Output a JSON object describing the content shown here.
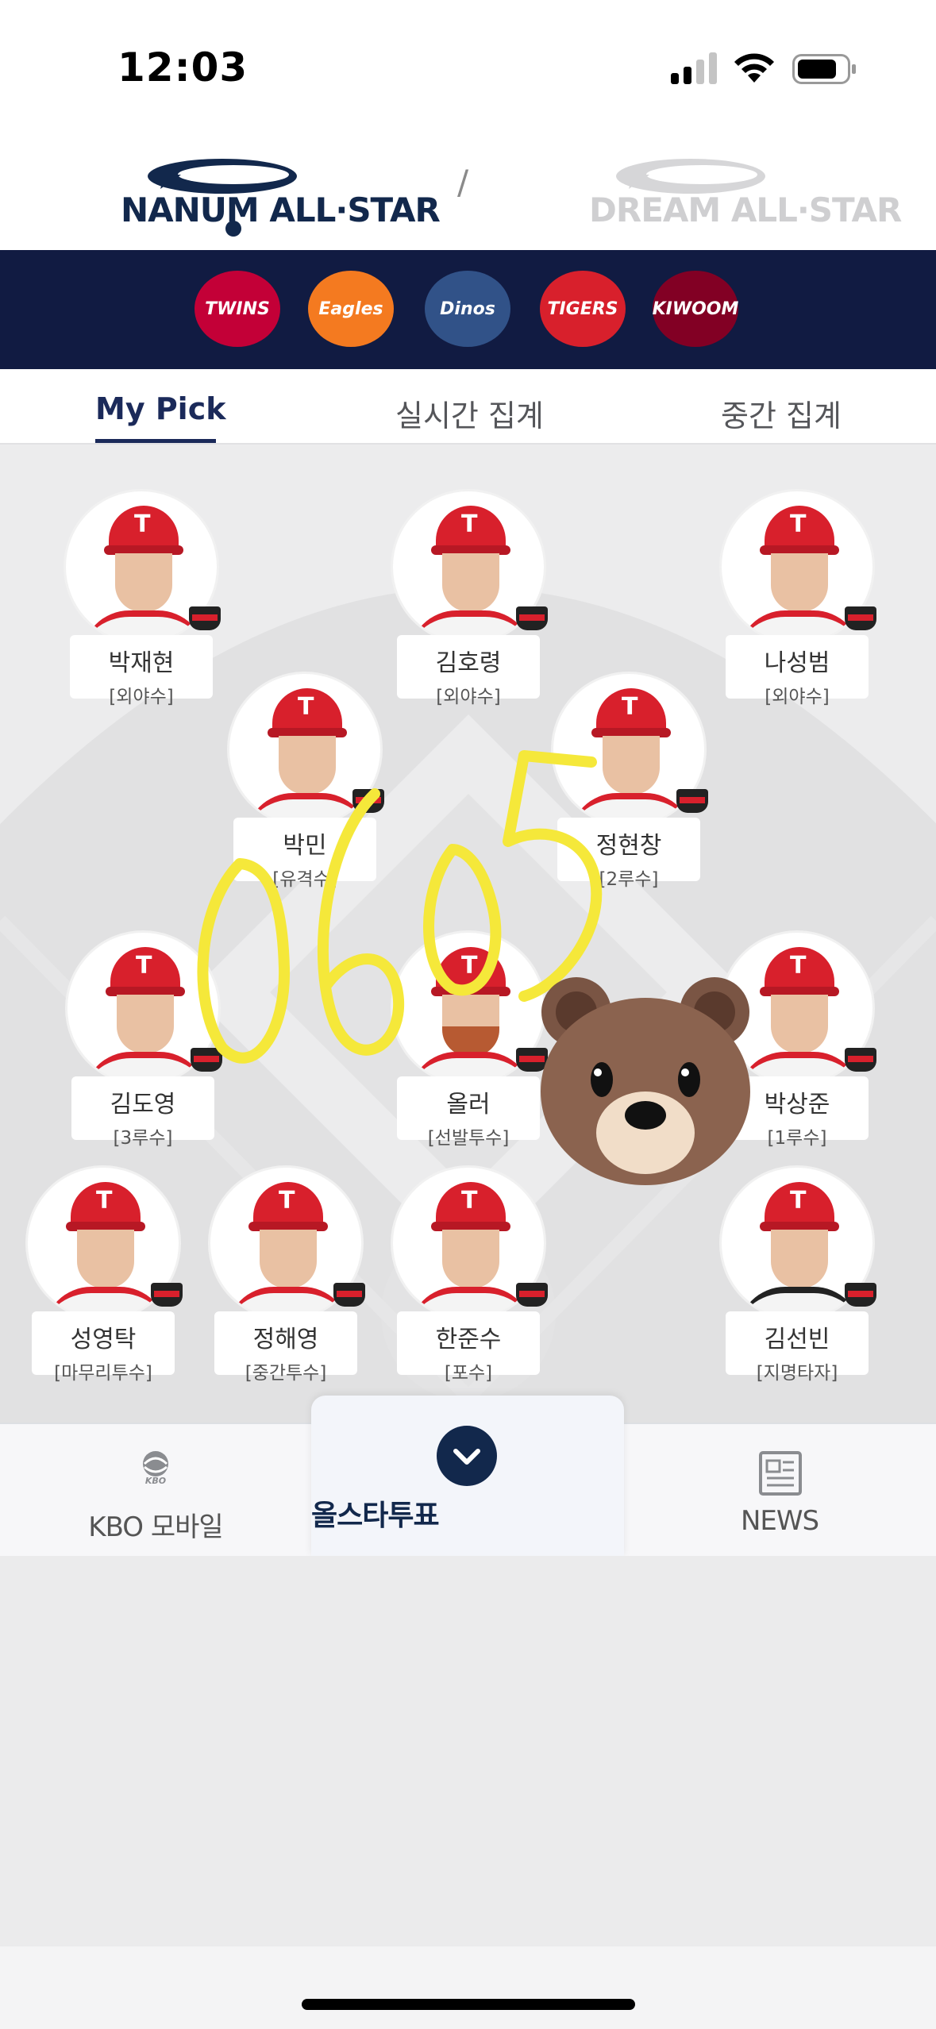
{
  "status_bar": {
    "time": "12:03"
  },
  "header": {
    "logo_nanum": "NANUM ALL·STAR",
    "separator": "/",
    "logo_dream": "DREAM ALL·STAR"
  },
  "teams": [
    {
      "name": "TWINS",
      "color": "#c30037"
    },
    {
      "name": "Eagles",
      "color": "#f47a20"
    },
    {
      "name": "Dinos",
      "color": "#315288"
    },
    {
      "name": "TIGERS",
      "color": "#d8202c"
    },
    {
      "name": "KIWOOM",
      "color": "#820024"
    }
  ],
  "tabs": [
    "My Pick",
    "실시간 집계",
    "중간 집계"
  ],
  "players": [
    {
      "name": "박재현",
      "position": "[외야수]"
    },
    {
      "name": "김호령",
      "position": "[외야수]"
    },
    {
      "name": "나성범",
      "position": "[외야수]"
    },
    {
      "name": "박민",
      "position": "[유격수]"
    },
    {
      "name": "정현창",
      "position": "[2루수]"
    },
    {
      "name": "김도영",
      "position": "[3루수]"
    },
    {
      "name": "올러",
      "position": "[선발투수]"
    },
    {
      "name": "박상준",
      "position": "[1루수]"
    },
    {
      "name": "성영탁",
      "position": "[마무리투수]"
    },
    {
      "name": "정해영",
      "position": "[중간투수]"
    },
    {
      "name": "한준수",
      "position": "[포수]"
    },
    {
      "name": "김선빈",
      "position": "[지명타자]"
    }
  ],
  "doodle_text": "0605",
  "bottom_nav": {
    "kbo": "KBO 모바일",
    "kbo_logo": "KBO",
    "allstar": "올스타투표",
    "news": "NEWS"
  },
  "icons": {
    "kbo": "kbo-logo-icon",
    "allstar": "chevron-down-icon",
    "news": "newspaper-icon"
  },
  "colors": {
    "navy": "#12284c",
    "team_bar": "#111b42",
    "tigers_red": "#d8202c",
    "doodle": "#f5e83a"
  }
}
